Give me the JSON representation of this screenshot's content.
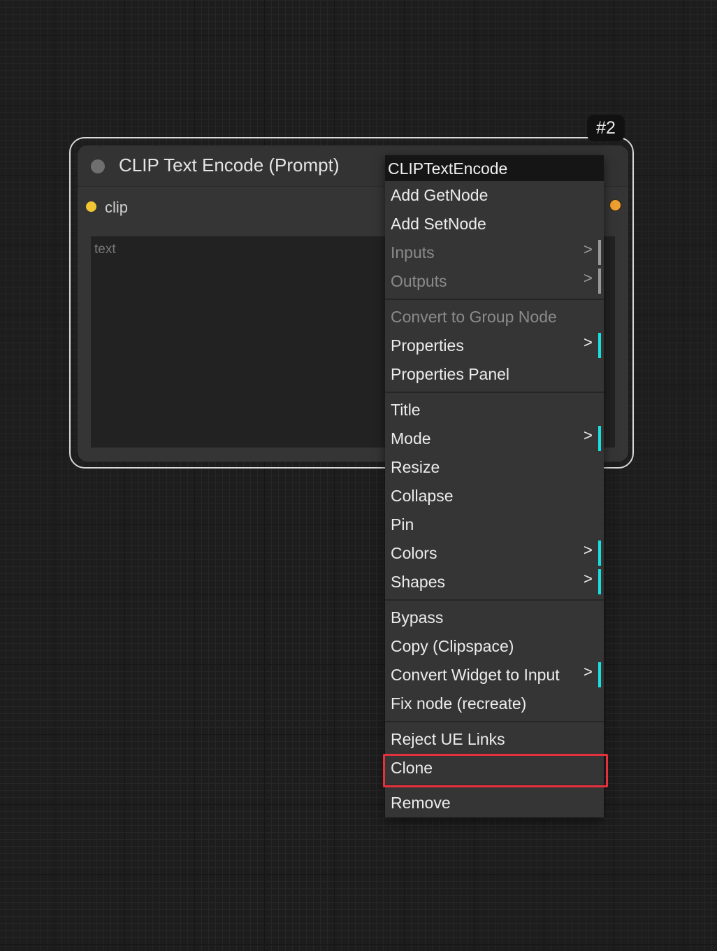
{
  "node": {
    "id_badge": "#2",
    "title": "CLIP Text Encode (Prompt)",
    "input_label": "clip",
    "text_placeholder": "text",
    "text_value": ""
  },
  "context_menu": {
    "header": "CLIPTextEncode",
    "submenu_arrow": ">",
    "items": {
      "add_getnode": "Add GetNode",
      "add_setnode": "Add SetNode",
      "inputs": "Inputs",
      "outputs": "Outputs",
      "convert_group": "Convert to Group Node",
      "properties": "Properties",
      "properties_panel": "Properties Panel",
      "title": "Title",
      "mode": "Mode",
      "resize": "Resize",
      "collapse": "Collapse",
      "pin": "Pin",
      "colors": "Colors",
      "shapes": "Shapes",
      "bypass": "Bypass",
      "copy_clipspace": "Copy (Clipspace)",
      "convert_widget": "Convert Widget to Input",
      "fix_node": "Fix node (recreate)",
      "reject_ue_links": "Reject UE Links",
      "clone": "Clone",
      "remove": "Remove"
    }
  },
  "colors": {
    "input_slot": "#f2c533",
    "output_slot": "#f0a030",
    "submenu_indicator": "#18e0e0",
    "highlight": "#e5303d"
  },
  "icons": {
    "collapse": "circle-dot-icon",
    "input_slot": "slot-dot-icon",
    "output_slot": "slot-dot-icon"
  }
}
